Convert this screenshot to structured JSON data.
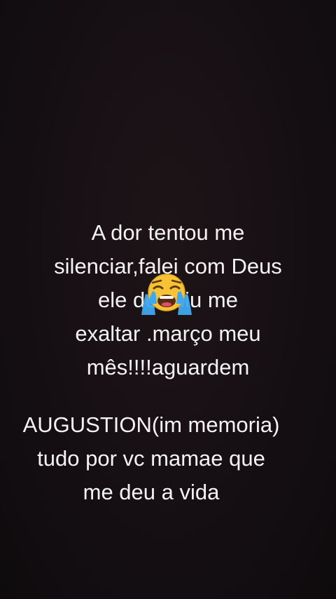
{
  "story": {
    "caption_lines": [
      "A dor tentou me",
      "silenciar,falei com Deus",
      "ele decidiu me",
      "exaltar .março meu",
      "mês!!!!aguardem"
    ],
    "dedication_lines": [
      "AUGUSTION(im memoria)",
      "tudo por vc mamae que",
      "me deu a vida"
    ],
    "sticker": "loudly-crying-face-icon",
    "colors": {
      "background": "#150f13",
      "text": "#f4f2f3",
      "emoji_face": "#f7c234",
      "emoji_tears": "#3fa8f0"
    }
  }
}
